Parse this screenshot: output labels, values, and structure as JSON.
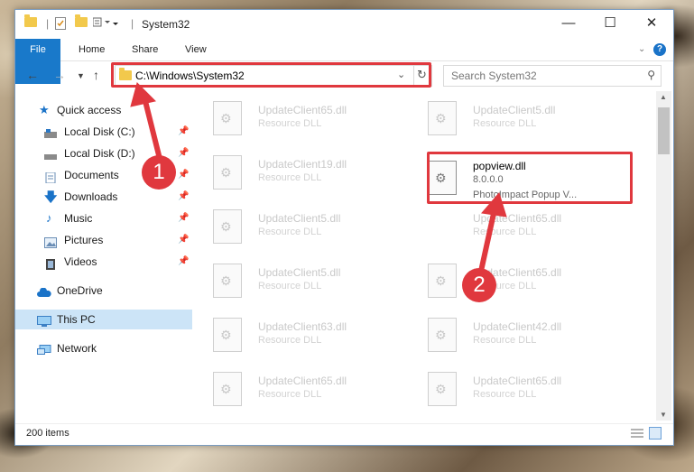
{
  "window": {
    "title": "System32"
  },
  "ribbon": {
    "tabs": [
      "File",
      "Home",
      "Share",
      "View"
    ]
  },
  "address": {
    "path": "C:\\Windows\\System32"
  },
  "search": {
    "placeholder": "Search System32"
  },
  "sidebar": {
    "items": [
      {
        "label": "Quick access"
      },
      {
        "label": "Local Disk (C:)"
      },
      {
        "label": "Local Disk (D:)"
      },
      {
        "label": "Documents"
      },
      {
        "label": "Downloads"
      },
      {
        "label": "Music"
      },
      {
        "label": "Pictures"
      },
      {
        "label": "Videos"
      },
      {
        "label": "OneDrive"
      },
      {
        "label": "This PC"
      },
      {
        "label": "Network"
      }
    ]
  },
  "files": {
    "left": [
      {
        "name": "UpdateClient65.dll",
        "desc": "Resource DLL"
      },
      {
        "name": "UpdateClient19.dll",
        "desc": "Resource DLL"
      },
      {
        "name": "UpdateClient5.dll",
        "desc": "Resource DLL"
      },
      {
        "name": "UpdateClient5.dll",
        "desc": "Resource DLL"
      },
      {
        "name": "UpdateClient63.dll",
        "desc": "Resource DLL"
      },
      {
        "name": "UpdateClient65.dll",
        "desc": "Resource DLL"
      }
    ],
    "right": [
      {
        "name": "UpdateClient5.dll",
        "desc": "Resource DLL"
      },
      {
        "name": "UpdateClient65.dll",
        "desc": "Resource DLL"
      },
      {
        "name": "UpdateClient65.dll",
        "desc": "Resource DLL"
      },
      {
        "name": "UpdateClient42.dll",
        "desc": "Resource DLL"
      },
      {
        "name": "UpdateClient65.dll",
        "desc": "Resource DLL"
      }
    ],
    "highlighted": {
      "name": "popview.dll",
      "version": "8.0.0.0",
      "desc": "PhotoImpact Popup V..."
    }
  },
  "status": {
    "count": "200 items"
  },
  "annotations": {
    "step1": "1",
    "step2": "2"
  },
  "colors": {
    "accent": "#1979ca",
    "highlight": "#e0383e",
    "selected": "#cce4f7"
  }
}
